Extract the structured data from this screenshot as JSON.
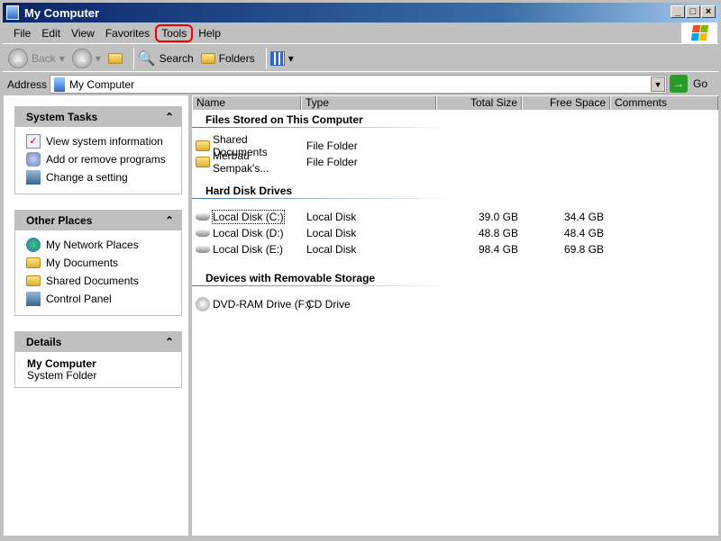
{
  "window": {
    "title": "My Computer"
  },
  "menu": [
    "File",
    "Edit",
    "View",
    "Favorites",
    "Tools",
    "Help"
  ],
  "toolbar": {
    "back": "Back",
    "search": "Search",
    "folders": "Folders"
  },
  "address": {
    "label": "Address",
    "value": "My Computer",
    "go": "Go"
  },
  "left": {
    "system_tasks": {
      "title": "System Tasks",
      "items": [
        "View system information",
        "Add or remove programs",
        "Change a setting"
      ]
    },
    "other_places": {
      "title": "Other Places",
      "items": [
        "My Network Places",
        "My Documents",
        "Shared Documents",
        "Control Panel"
      ]
    },
    "details": {
      "title": "Details",
      "name": "My Computer",
      "type": "System Folder"
    }
  },
  "columns": [
    "Name",
    "Type",
    "Total Size",
    "Free Space",
    "Comments"
  ],
  "groups": {
    "files": {
      "title": "Files Stored on This Computer",
      "items": [
        {
          "name": "Shared Documents",
          "type": "File Folder"
        },
        {
          "name": "Merbau Sempak's...",
          "type": "File Folder"
        }
      ]
    },
    "disks": {
      "title": "Hard Disk Drives",
      "items": [
        {
          "name": "Local Disk (C:)",
          "type": "Local Disk",
          "total": "39.0 GB",
          "free": "34.4 GB"
        },
        {
          "name": "Local Disk (D:)",
          "type": "Local Disk",
          "total": "48.8 GB",
          "free": "48.4 GB"
        },
        {
          "name": "Local Disk (E:)",
          "type": "Local Disk",
          "total": "98.4 GB",
          "free": "69.8 GB"
        }
      ]
    },
    "removable": {
      "title": "Devices with Removable Storage",
      "items": [
        {
          "name": "DVD-RAM Drive (F:)",
          "type": "CD Drive"
        }
      ]
    }
  },
  "colors": {
    "title_bar": "#0a246a",
    "highlight": "#e00000"
  }
}
